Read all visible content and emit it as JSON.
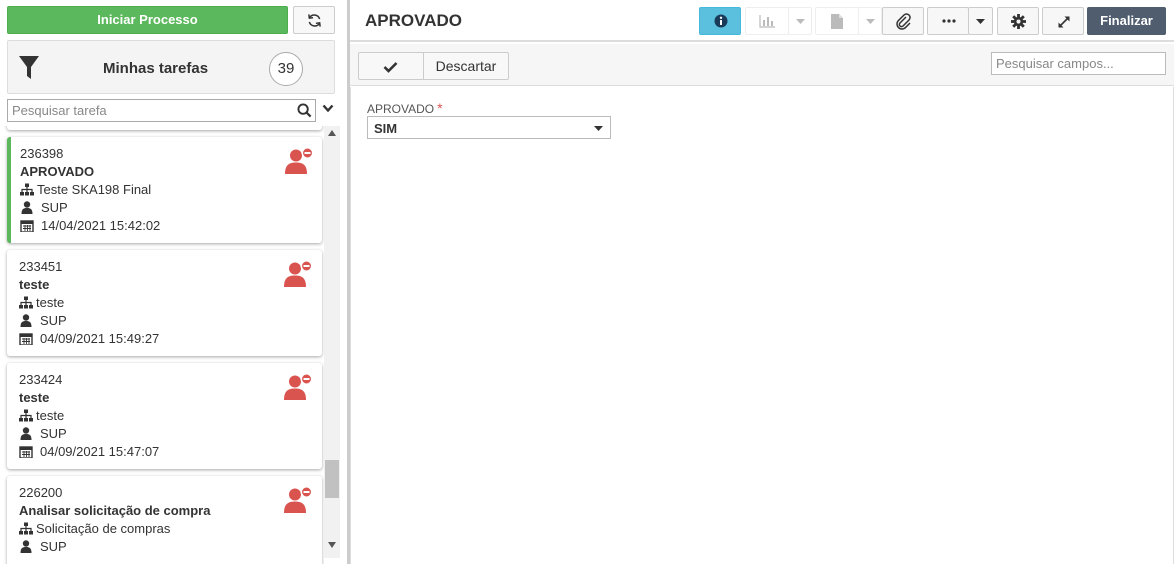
{
  "left": {
    "start_button": "Iniciar Processo",
    "my_tasks_label": "Minhas tarefas",
    "task_count": "39",
    "search_placeholder": "Pesquisar tarefa"
  },
  "tasks": [
    {
      "id": "236398",
      "title": "APROVADO",
      "process": "Teste SKA198 Final",
      "user": "SUP",
      "date": "14/04/2021 15:42:02",
      "active": true
    },
    {
      "id": "233451",
      "title": "teste",
      "process": "teste",
      "user": "SUP",
      "date": "04/09/2021 15:49:27",
      "active": false
    },
    {
      "id": "233424",
      "title": "teste",
      "process": "teste",
      "user": "SUP",
      "date": "04/09/2021 15:47:07",
      "active": false
    },
    {
      "id": "226200",
      "title": "Analisar solicitação de compra",
      "process": "Solicitação de compras",
      "user": "SUP",
      "date": "",
      "active": false
    }
  ],
  "header": {
    "title": "APROVADO",
    "finish_button": "Finalizar"
  },
  "formbar": {
    "discard_button": "Descartar",
    "search_placeholder": "Pesquisar campos..."
  },
  "form": {
    "field_label": "APROVADO",
    "required_mark": "*",
    "field_value": "SIM"
  },
  "colors": {
    "primary_green": "#5cb85c",
    "info_blue": "#5bc0de",
    "finish_dark": "#4f5d6e",
    "danger_red": "#d9534f"
  }
}
